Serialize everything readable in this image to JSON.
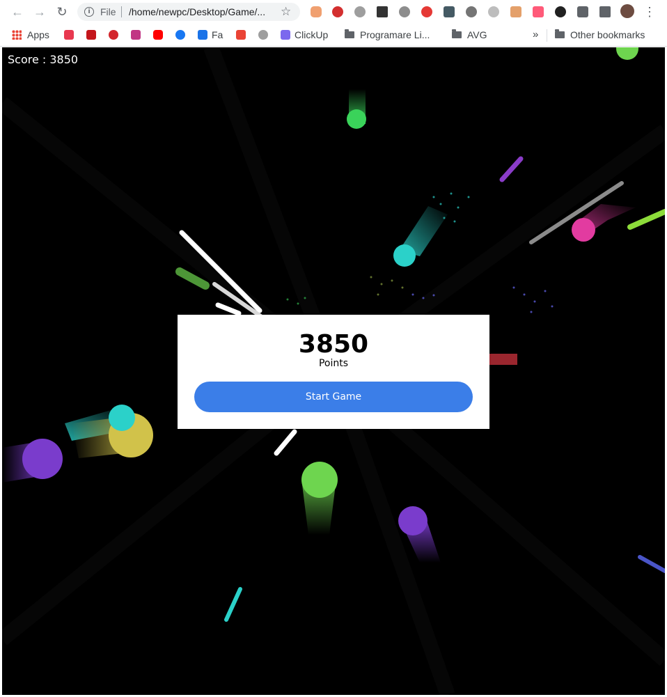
{
  "browser": {
    "address_prefix": "File",
    "url": "/home/newpc/Desktop/Game/...",
    "nav": {
      "back_icon": "←",
      "forward_icon": "→",
      "reload_icon": "↻",
      "star_icon": "☆",
      "menu_icon": "⋮"
    }
  },
  "bookmarks": {
    "apps_label": "Apps",
    "items": [
      {
        "label": "",
        "color": "#e8384f"
      },
      {
        "label": "",
        "color": "#e23b4a"
      },
      {
        "label": "",
        "color": "#d3262c"
      },
      {
        "label": "",
        "color": "#c13584"
      },
      {
        "label": "",
        "color": "#ff0000"
      },
      {
        "label": "",
        "color": "#1877f2"
      },
      {
        "label": "Fa",
        "color": "#1a73e8"
      },
      {
        "label": "",
        "color": "#ea4335"
      },
      {
        "label": "",
        "color": "#9e9e9e"
      },
      {
        "label": "ClickUp",
        "color": "#7b68ee"
      }
    ],
    "folders": [
      "Programare Li...",
      "AVG"
    ],
    "overflow": "»",
    "other": "Other bookmarks"
  },
  "game": {
    "score_label": "Score : 3850",
    "modal": {
      "score": "3850",
      "points_label": "Points",
      "start_button": "Start Game"
    }
  }
}
